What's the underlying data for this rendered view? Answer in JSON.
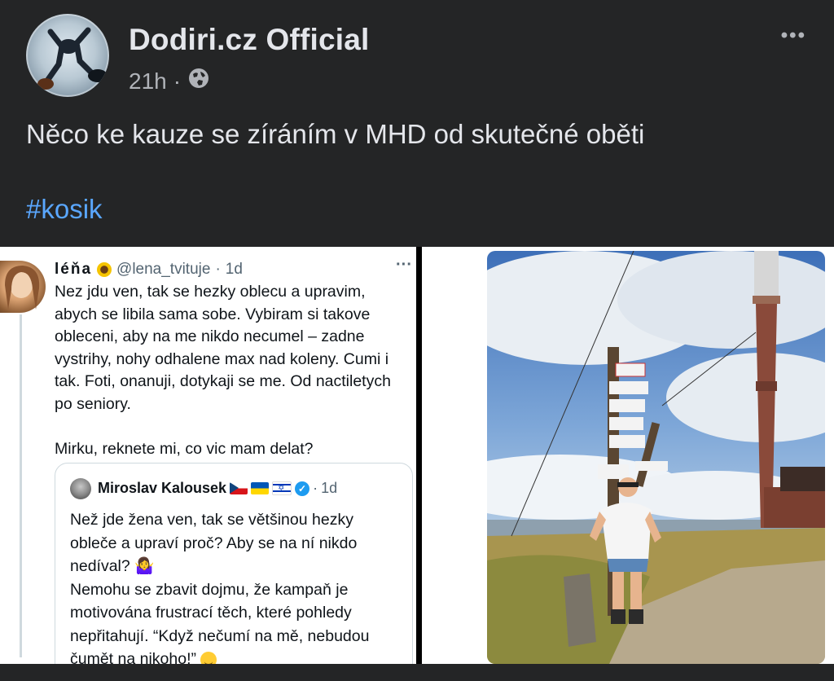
{
  "post": {
    "page_name": "Dodiri.cz Official",
    "time": "21h",
    "separator": "·",
    "audience_icon": "globe-icon",
    "more_label": "•••",
    "text": "Něco ke kauze se zíráním v MHD od skutečné oběti",
    "hashtag": "#kosik"
  },
  "tweet": {
    "name": "léňa",
    "name_emoji": "sunflower-icon",
    "handle": "@lena_tvituje",
    "dot": "·",
    "age": "1d",
    "more_label": "···",
    "body": "Nez jdu ven, tak se hezky oblecu a upravim,\nabych se libila sama sobe. Vybiram si takove\nobleceni, aby na me nikdo necumel – zadne\nvystrihy, nohy odhalene max nad koleny. Cumi i\ntak. Foti, onanuji, dotykaji se me. Od nactiletych\npo seniory.\n\nMirku, reknete mi, co vic mam delat?"
  },
  "quote": {
    "name": "Miroslav Kalousek",
    "flags": [
      "flag-cz-icon",
      "flag-ua-icon",
      "flag-il-icon"
    ],
    "verified_icon": "verified-icon",
    "verified_mark": "✓",
    "dot": "·",
    "age": "1d",
    "body_1": "Než jde žena ven, tak se většinou hezky\nobleče a upraví proč? Aby se na ní nikdo\nnedíval? 🤷‍♀️\nNemohu se zbavit dojmu, že kampaň je\nmotivována frustrací těch, které pohledy\nnepřitahují. “Když nečumí na mě, nebudou\nčumět na nikoho!”",
    "end_emoji": "grinning-face-icon"
  },
  "photo": {
    "subject": "photo-icon"
  }
}
